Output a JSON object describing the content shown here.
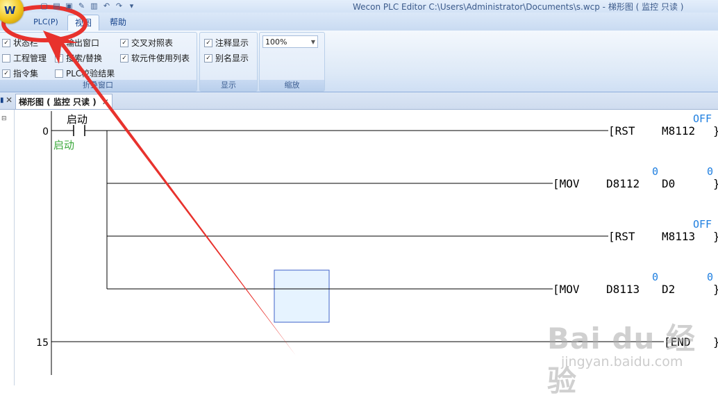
{
  "app": {
    "orb_text": "W",
    "title": "Wecon PLC Editor  C:\\Users\\Administrator\\Documents\\s.wcp  - 梯形图 ( 监控 只读 )"
  },
  "quick_access": [
    {
      "icon": "new-file-icon",
      "glyph": "▢"
    },
    {
      "icon": "open-folder-icon",
      "glyph": "▤"
    },
    {
      "icon": "save-icon",
      "glyph": "▣"
    },
    {
      "icon": "edit-icon",
      "glyph": "✎"
    },
    {
      "icon": "folder-icon",
      "glyph": "▥"
    },
    {
      "icon": "undo-icon",
      "glyph": "↶"
    },
    {
      "icon": "redo-icon",
      "glyph": "↷"
    },
    {
      "icon": "qat-dropdown-icon",
      "glyph": "▾"
    }
  ],
  "tabs": [
    {
      "id": "plc",
      "label": "PLC(P)"
    },
    {
      "id": "view",
      "label": "视图"
    },
    {
      "id": "help",
      "label": "帮助"
    }
  ],
  "ribbon": {
    "window_group": {
      "label": "折叠窗口",
      "items": [
        {
          "label": "状态栏",
          "checked": true
        },
        {
          "label": "输出窗口",
          "checked": true
        },
        {
          "label": "交叉对照表",
          "checked": true
        },
        {
          "label": "工程管理",
          "checked": false
        },
        {
          "label": "搜索/替换",
          "checked": true
        },
        {
          "label": "软元件使用列表",
          "checked": true
        },
        {
          "label": "指令集",
          "checked": true
        },
        {
          "label": "PLC校验结果",
          "checked": false
        }
      ]
    },
    "display_group": {
      "label": "显示",
      "items": [
        {
          "label": "注释显示",
          "checked": true
        },
        {
          "label": "别名显示",
          "checked": true
        }
      ]
    },
    "zoom_group": {
      "label": "缩放",
      "value": "100%"
    }
  },
  "document_tab": {
    "label": "梯形图 ( 监控 只读 )"
  },
  "ladder": {
    "rungs": [
      {
        "step": "0"
      },
      {
        "step": "15"
      }
    ],
    "contact": {
      "device": "启动",
      "comment": "启动"
    },
    "instructions": [
      {
        "op": "[RST",
        "arg1": "M8112",
        "close": "}",
        "mon1": "OFF",
        "mon2": ""
      },
      {
        "op": "[MOV",
        "arg1": "D8112",
        "arg2": "D0",
        "close": "}",
        "mon1": "0",
        "mon2": "0"
      },
      {
        "op": "[RST",
        "arg1": "M8113",
        "close": "}",
        "mon1": "OFF",
        "mon2": ""
      },
      {
        "op": "[MOV",
        "arg1": "D8113",
        "arg2": "D2",
        "close": "}",
        "mon1": "0",
        "mon2": "0"
      },
      {
        "op": "[END",
        "close": "}"
      }
    ]
  },
  "watermark": {
    "logo": "Bai du 经验",
    "url": "jingyan.baidu.com"
  },
  "colors": {
    "monitor_value": "#1f7fe0",
    "comment_green": "#3aa83a",
    "annotation_red": "#e8322d",
    "cursor_fill": "#e6f3ff",
    "cursor_border": "#3e62c8"
  }
}
